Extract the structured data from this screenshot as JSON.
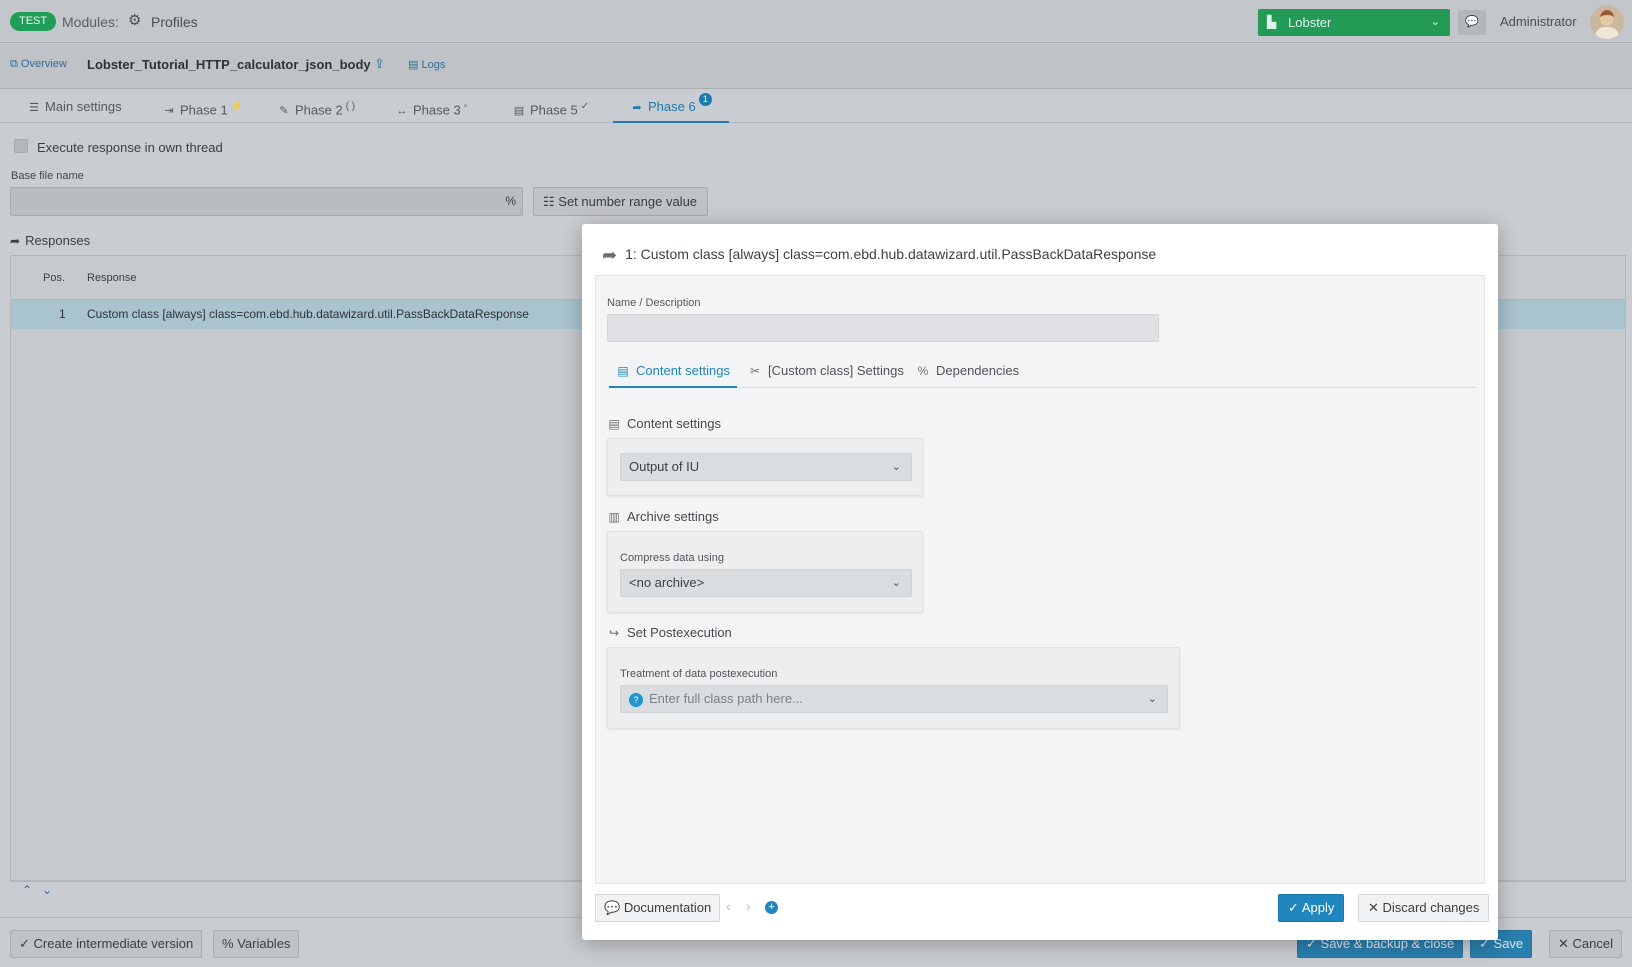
{
  "topbar": {
    "env_badge": "TEST",
    "modules_label": "Modules:",
    "modules_value": "Profiles",
    "tenant": "Lobster",
    "user": "Administrator"
  },
  "subbar": {
    "overview": "Overview",
    "profile_name": "Lobster_Tutorial_HTTP_calculator_json_body",
    "logs": "Logs"
  },
  "phase_tabs": [
    {
      "label": "Main settings",
      "icon": "list-icon",
      "marker": ""
    },
    {
      "label": "Phase 1",
      "icon": "sign-in-icon",
      "marker": "⚡"
    },
    {
      "label": "Phase 2",
      "icon": "edit-icon",
      "marker": "( )"
    },
    {
      "label": "Phase 3",
      "icon": "arrows-h-icon",
      "marker": "▫"
    },
    {
      "label": "Phase 5",
      "icon": "server-icon",
      "marker": "✓"
    },
    {
      "label": "Phase 6",
      "icon": "share-icon",
      "marker": "1"
    }
  ],
  "main": {
    "execute_label": "Execute response in own thread",
    "base_file_label": "Base file name",
    "range_button": "Set number range value",
    "responses_title": "Responses",
    "table": {
      "headers": [
        "Pos.",
        "Response"
      ],
      "rows": [
        {
          "pos": "1",
          "response": "Custom class [always] class=com.ebd.hub.datawizard.util.PassBackDataResponse"
        }
      ]
    }
  },
  "bottom": {
    "intermediate": "Create intermediate version",
    "variables": "Variables",
    "save_backup_close": "Save & backup & close",
    "save": "Save",
    "cancel": "Cancel"
  },
  "modal": {
    "title": "1: Custom class [always] class=com.ebd.hub.datawizard.util.PassBackDataResponse",
    "name_label": "Name / Description",
    "name_value": "",
    "tabs": [
      "Content settings",
      "[Custom class] Settings",
      "Dependencies"
    ],
    "content_settings": {
      "title": "Content settings",
      "selected": "Output of IU"
    },
    "archive_settings": {
      "title": "Archive settings",
      "compress_label": "Compress data using",
      "selected": "<no archive>"
    },
    "postexecution": {
      "title": "Set Postexecution",
      "treatment_label": "Treatment of data postexecution",
      "placeholder": "Enter full class path here..."
    },
    "footer": {
      "documentation": "Documentation",
      "apply": "Apply",
      "discard": "Discard changes"
    }
  },
  "colors": {
    "accent": "#1f86bf",
    "tenant_green": "#239a56",
    "row_selected": "#a9c3cf"
  }
}
